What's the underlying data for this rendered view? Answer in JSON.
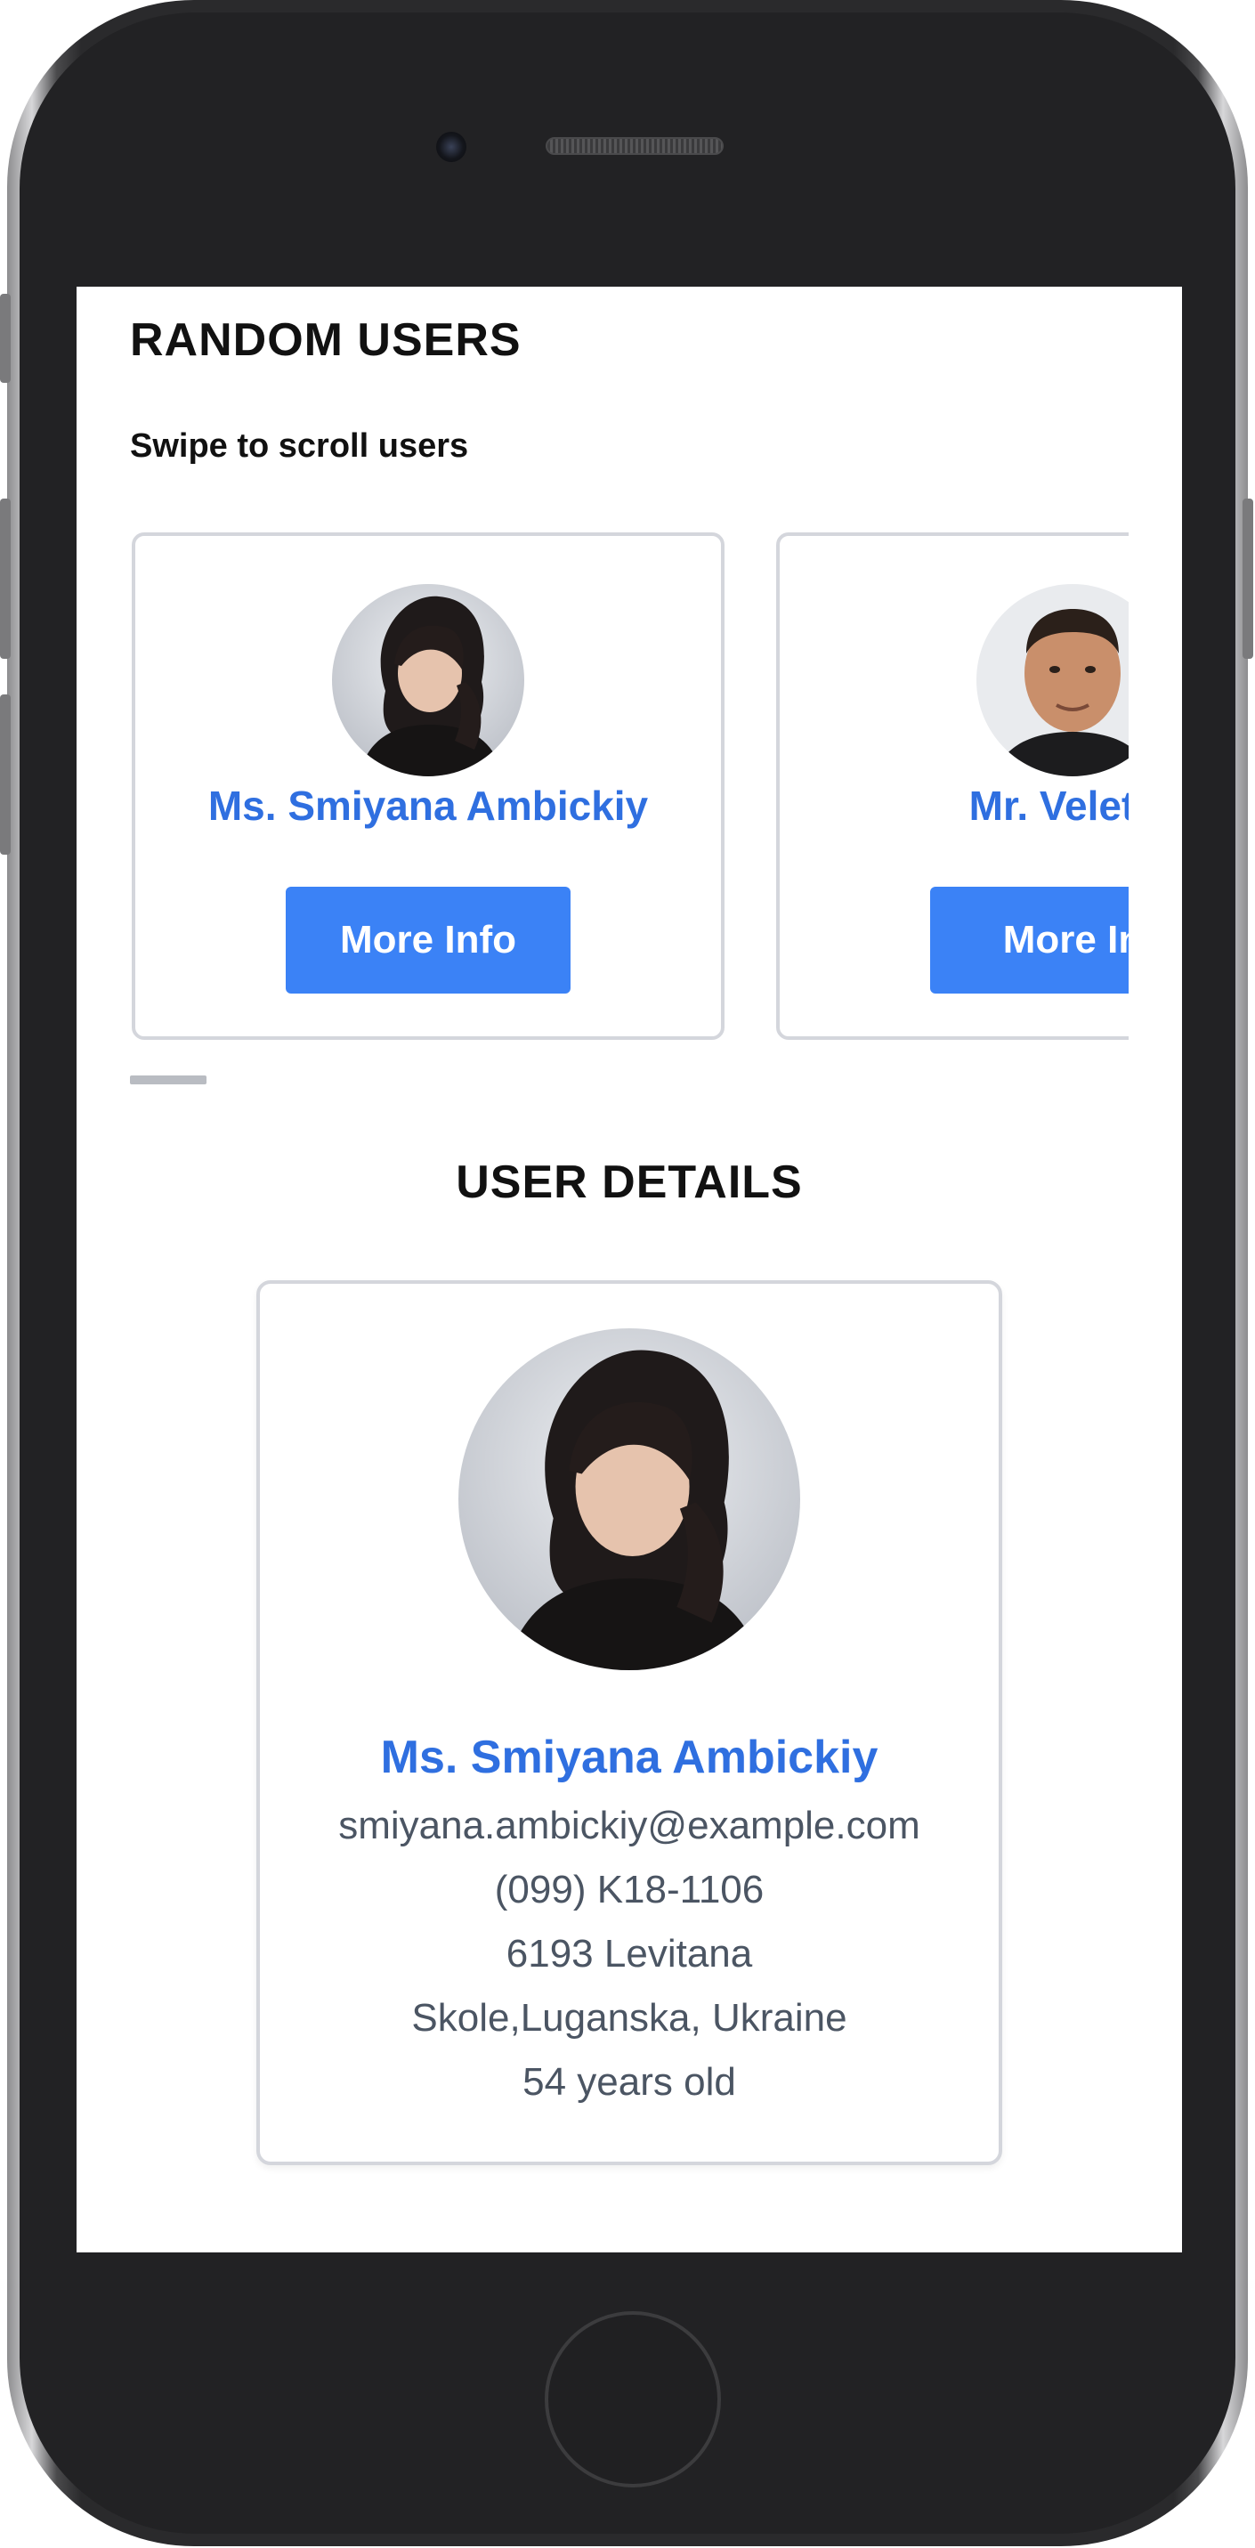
{
  "random_users": {
    "title": "RANDOM USERS",
    "subtitle": "Swipe to scroll users",
    "cards": [
      {
        "name": "Ms. Smiyana Ambickiy",
        "button_label": "More Info",
        "avatar": "woman-portrait-icon"
      },
      {
        "name": "Mr. Velet K",
        "button_label": "More In",
        "avatar": "man-portrait-icon"
      }
    ],
    "scroll_position": 0.0
  },
  "user_details": {
    "title": "USER DETAILS",
    "name": "Ms. Smiyana Ambickiy",
    "email": "smiyana.ambickiy@example.com",
    "phone": "(099) K18-1106",
    "street": "6193 Levitana",
    "location": "Skole,Luganska, Ukraine",
    "age": "54 years old"
  },
  "colors": {
    "accent": "#3b82f6",
    "name_text": "#2f6fe0",
    "detail_text": "#4b5563",
    "card_border": "#d4d6dc"
  }
}
